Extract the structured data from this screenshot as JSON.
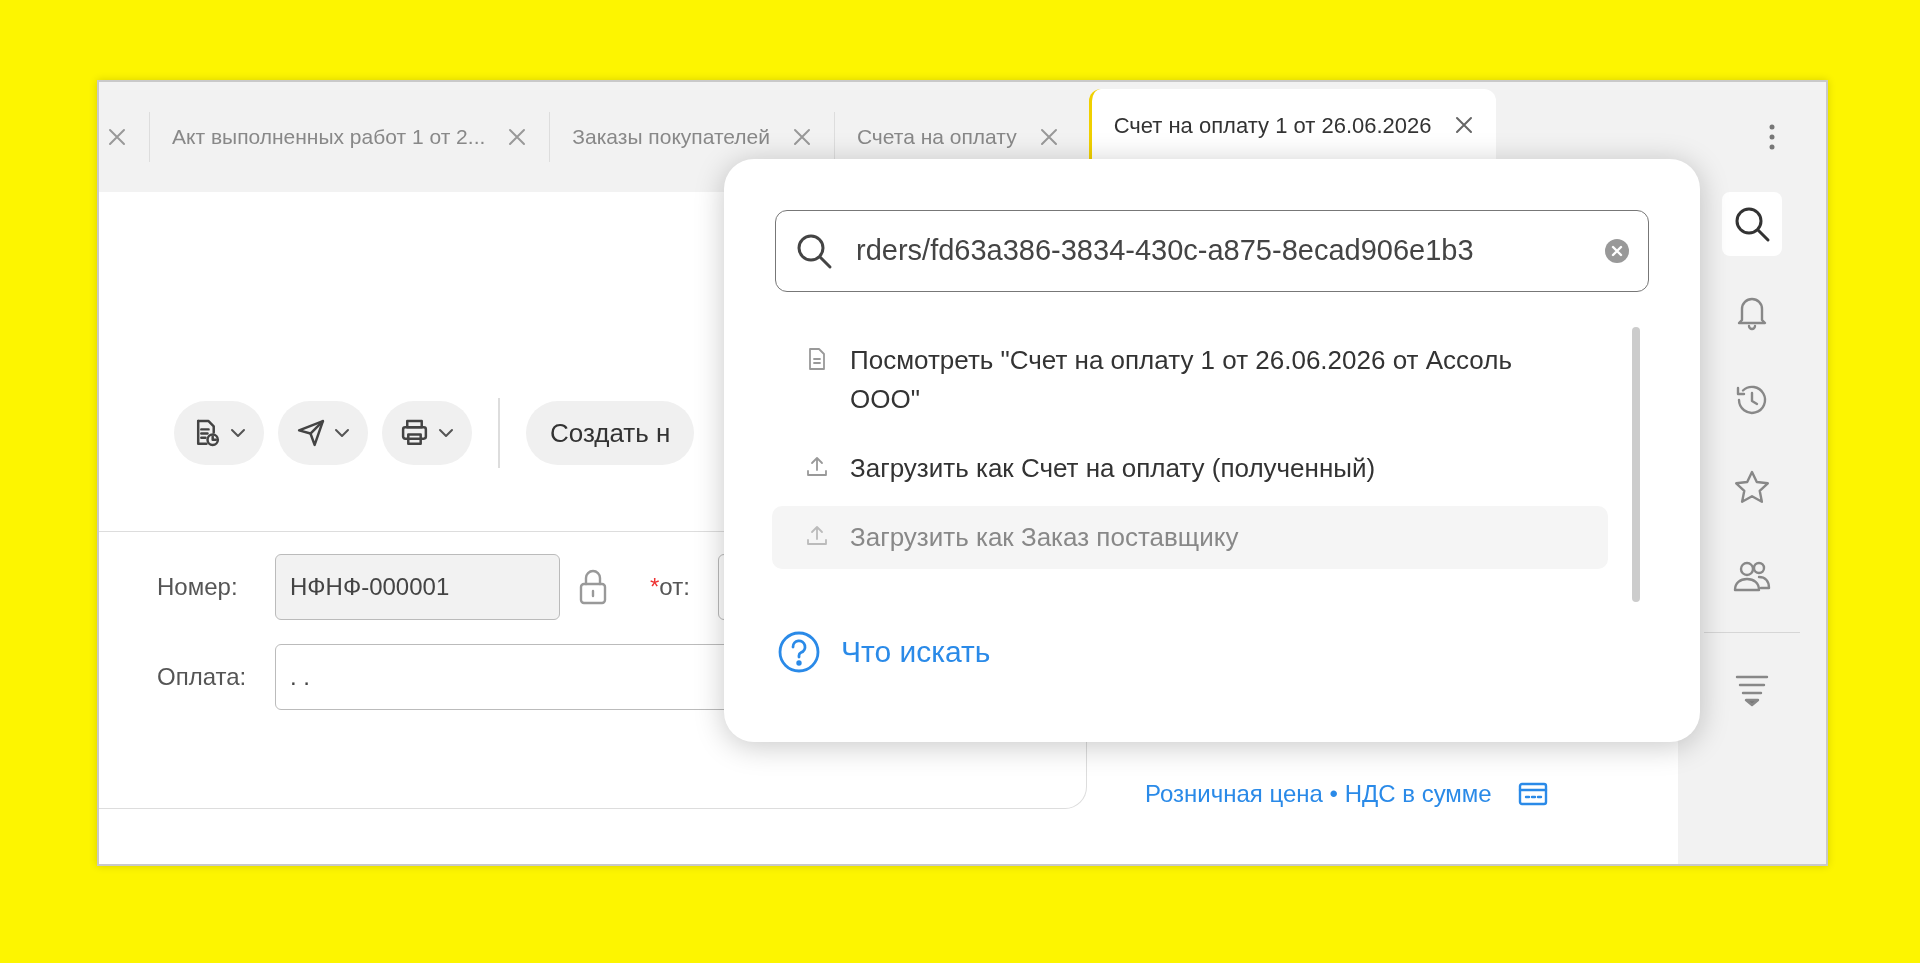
{
  "tabs": [
    {
      "selected": false
    },
    {
      "label": "Акт выполненных работ 1 от 2...",
      "selected": false
    },
    {
      "label": "Заказы покупателей",
      "selected": false
    },
    {
      "label": "Счета на оплату",
      "selected": false
    },
    {
      "label": "Счет на оплату 1 от 26.06.2026",
      "selected": true
    }
  ],
  "toolbar": {
    "buttons": [
      {
        "kind": "report"
      },
      {
        "kind": "send"
      },
      {
        "kind": "print"
      }
    ],
    "create_button": "Создать н"
  },
  "form": {
    "number_label": "Номер:",
    "number_value": "НФНФ-000001",
    "date_required": "*",
    "date_label": "от:",
    "payment_label": "Оплата:",
    "payment_value": ". ."
  },
  "price_link": "Розничная цена • НДС в сумме",
  "search_popup": {
    "query": "rders/fd63a386-3834-430c-a875-8ecad906e1b3",
    "results": [
      {
        "kind": "document",
        "text": "Посмотреть \"Счет на оплату 1 от 26.06.2026 от Ассоль ООО\"",
        "highlighted": false
      },
      {
        "kind": "upload",
        "text": "Загрузить как Счет на оплату (полученный)",
        "highlighted": false
      },
      {
        "kind": "upload",
        "text": "Загрузить как Заказ поставщику",
        "highlighted": true
      }
    ],
    "help_link": "Что искать"
  },
  "sidebar": {
    "items": [
      {
        "kind": "search",
        "selected": true
      },
      {
        "kind": "bell",
        "selected": false
      },
      {
        "kind": "history",
        "selected": false
      },
      {
        "kind": "star",
        "selected": false
      },
      {
        "kind": "people",
        "selected": false
      },
      {
        "kind": "divider"
      },
      {
        "kind": "filter",
        "selected": false
      }
    ]
  }
}
